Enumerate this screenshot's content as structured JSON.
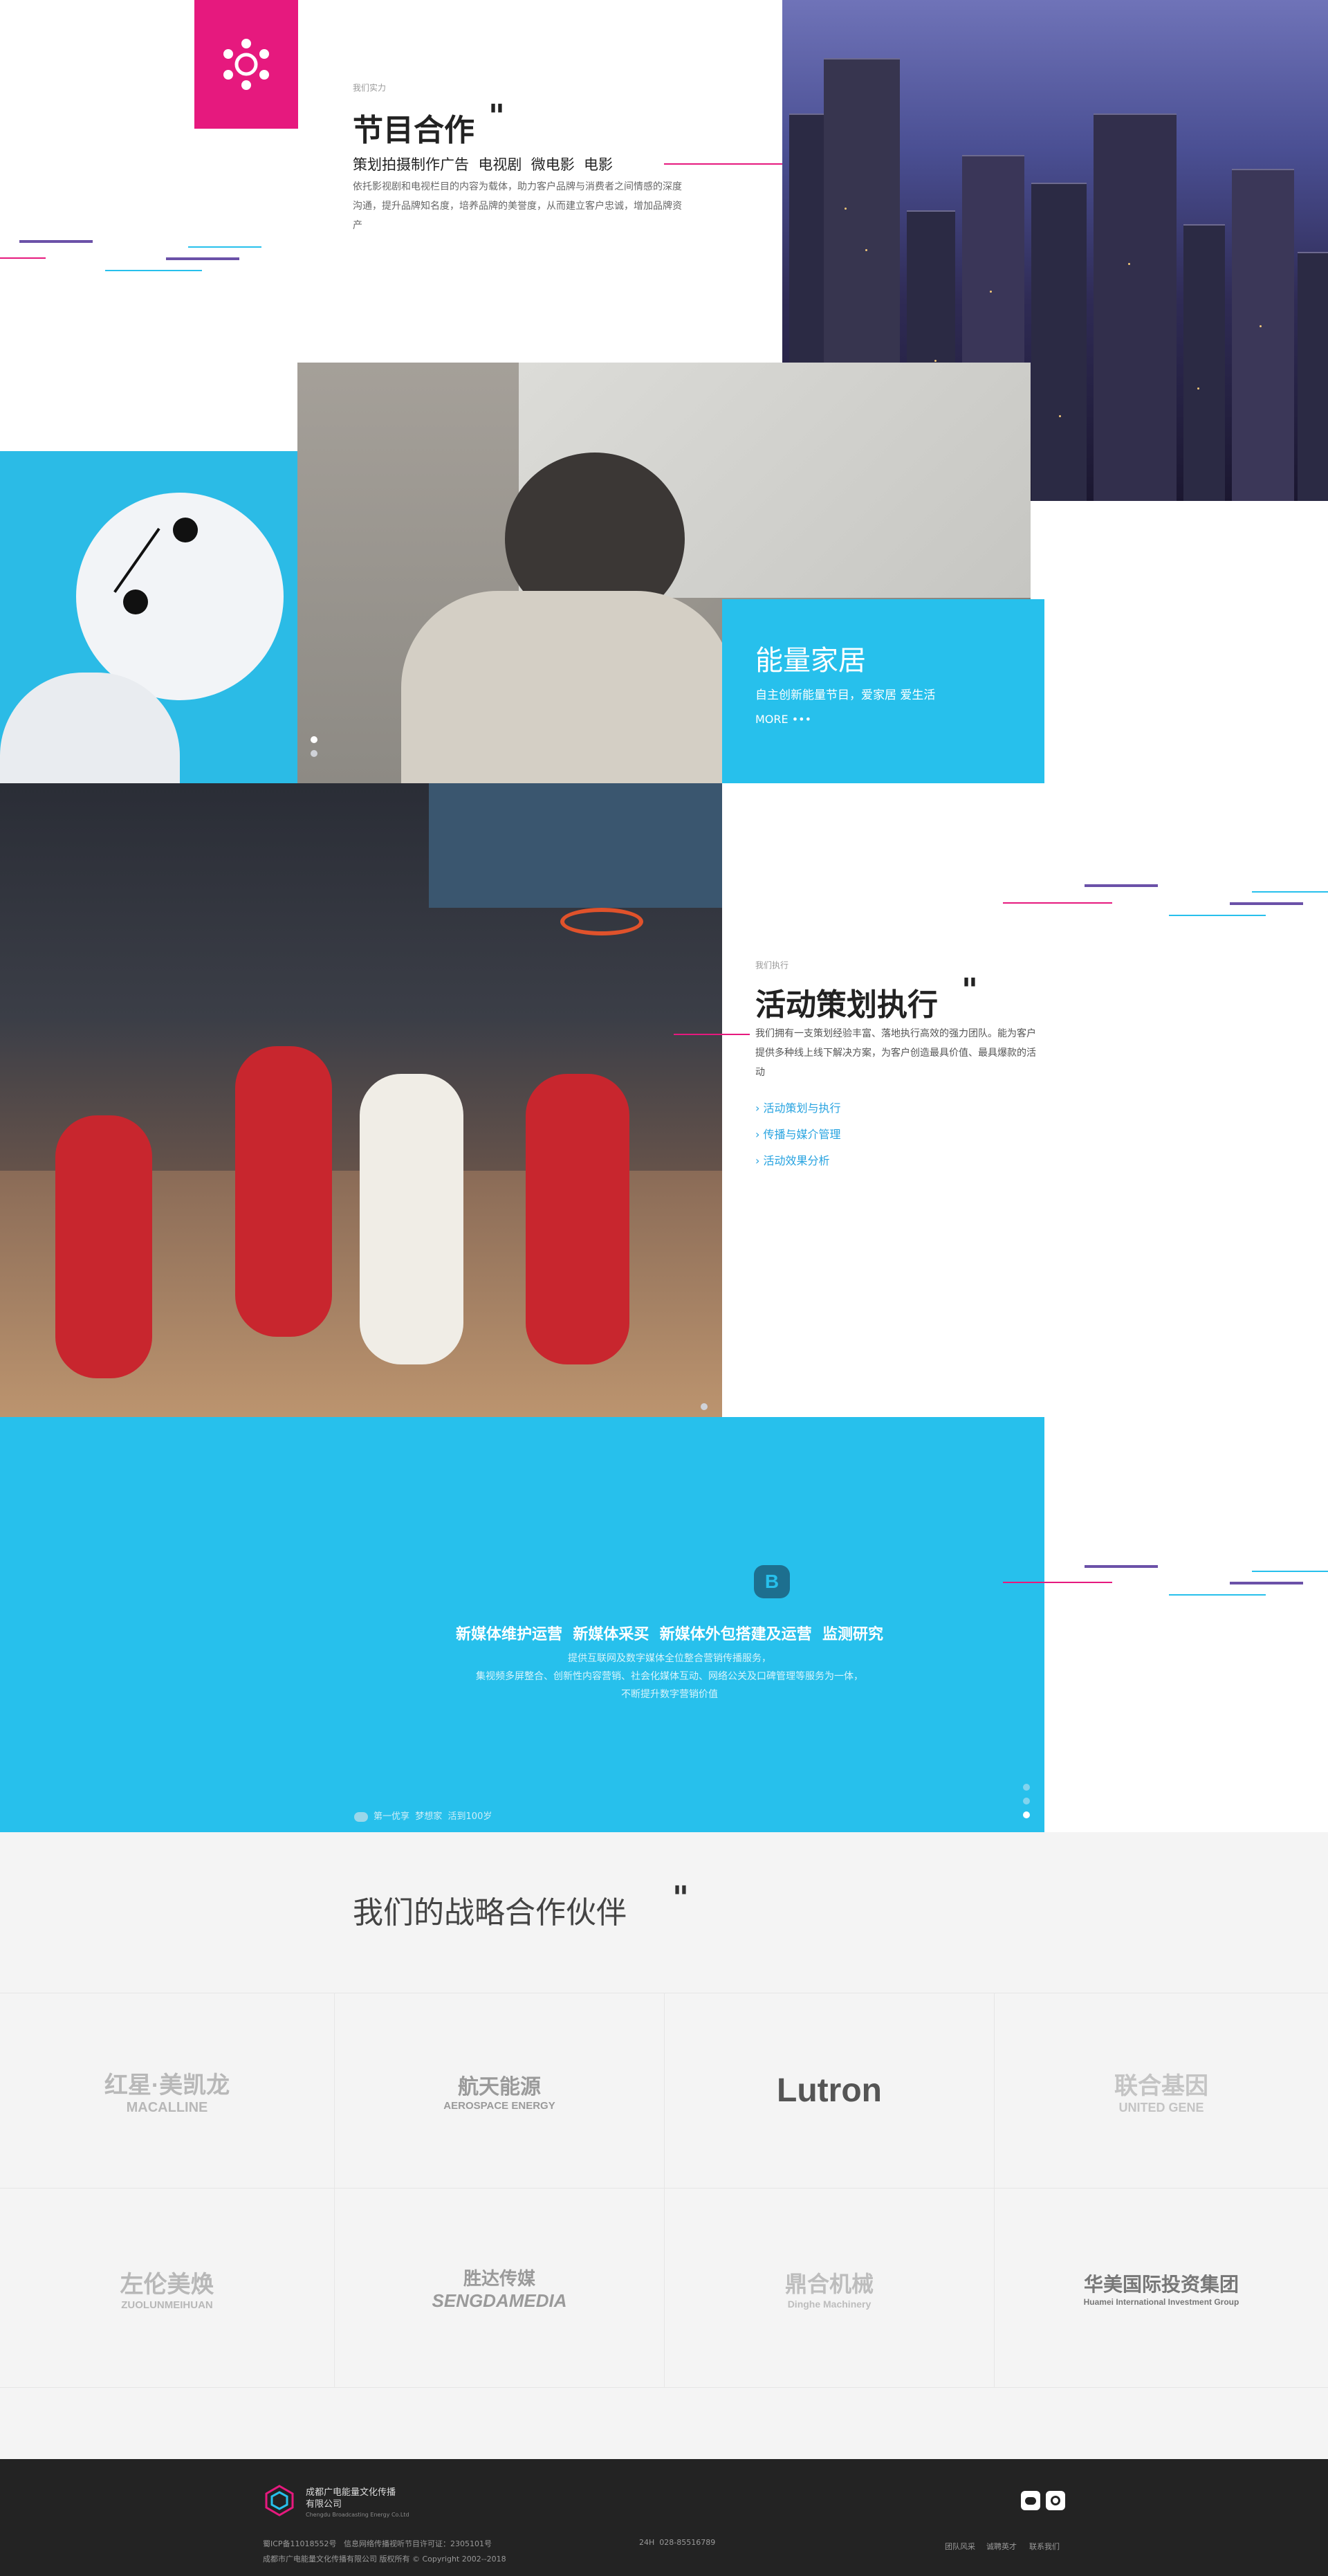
{
  "program": {
    "eyebrow": "我们实力",
    "title": "节目合作",
    "subtitle": "策划拍摄制作广告  电视剧  微电影  电影",
    "desc": "依托影视剧和电视栏目的内容为载体，助力客户品牌与消费者之间情感的深度沟通，提升品牌知名度，培养品牌的美誉度，从而建立客户忠诚，增加品牌资产"
  },
  "home": {
    "title": "能量家居",
    "subtitle": "自主创新能量节目，爱家居 爱生活",
    "more": "MORE •••"
  },
  "event": {
    "eyebrow": "我们执行",
    "title": "活动策划执行",
    "desc": "我们拥有一支策划经验丰富、落地执行高效的强力团队。能为客户提供多种线上线下解决方案，为客户创造最具价值、最具爆款的活动",
    "links": [
      "活动策划与执行",
      "传播与媒介管理",
      "活动效果分析"
    ]
  },
  "media": {
    "headline": "新媒体维护运营  新媒体采买  新媒体外包搭建及运营  监测研究",
    "lines": [
      "提供互联网及数字媒体全位整合营销传播服务，",
      "集视频多屏整合、创新性内容营销、社会化媒体互动、网络公关及口碑管理等服务为一体，",
      "不断提升数字营销价值"
    ],
    "footer_note": "第一优享  梦想家  活到100岁"
  },
  "partners": {
    "title": "我们的战略合作伙伴",
    "logos": [
      {
        "name": "红星·美凯龙",
        "sub": "MACALLINE"
      },
      {
        "name": "航天能源",
        "sub": "AEROSPACE ENERGY"
      },
      {
        "name": "Lutron",
        "sub": ""
      },
      {
        "name": "联合基因",
        "sub": "UNITED GENE"
      },
      {
        "name": "左伦美焕",
        "sub": "ZUOLUNMEIHUAN"
      },
      {
        "name": "胜达传媒",
        "sub": "SENGDAMEDIA"
      },
      {
        "name": "鼎合机械",
        "sub": "Dinghe Machinery"
      },
      {
        "name": "华美国际投资集团",
        "sub": "Huamei International Investment Group"
      }
    ]
  },
  "footer": {
    "company": "成都广电能量文化传播有限公司",
    "company_en": "Chengdu Broadcasting Energy Co.Ltd",
    "icp": "蜀ICP备11018552号   信息网络传播视听节目许可证：2305101号",
    "copyright": "成都市广电能量文化传播有限公司 版权所有 © Copyright 2002--2018",
    "hotline": "24H  028-85516789",
    "links": [
      "团队风采",
      "诚聘英才",
      "联系我们"
    ]
  },
  "colors": {
    "accent_pink": "#e6197e",
    "accent_blue": "#27c0ec",
    "accent_purple": "#6b51a8",
    "footer_bg": "#232323"
  }
}
